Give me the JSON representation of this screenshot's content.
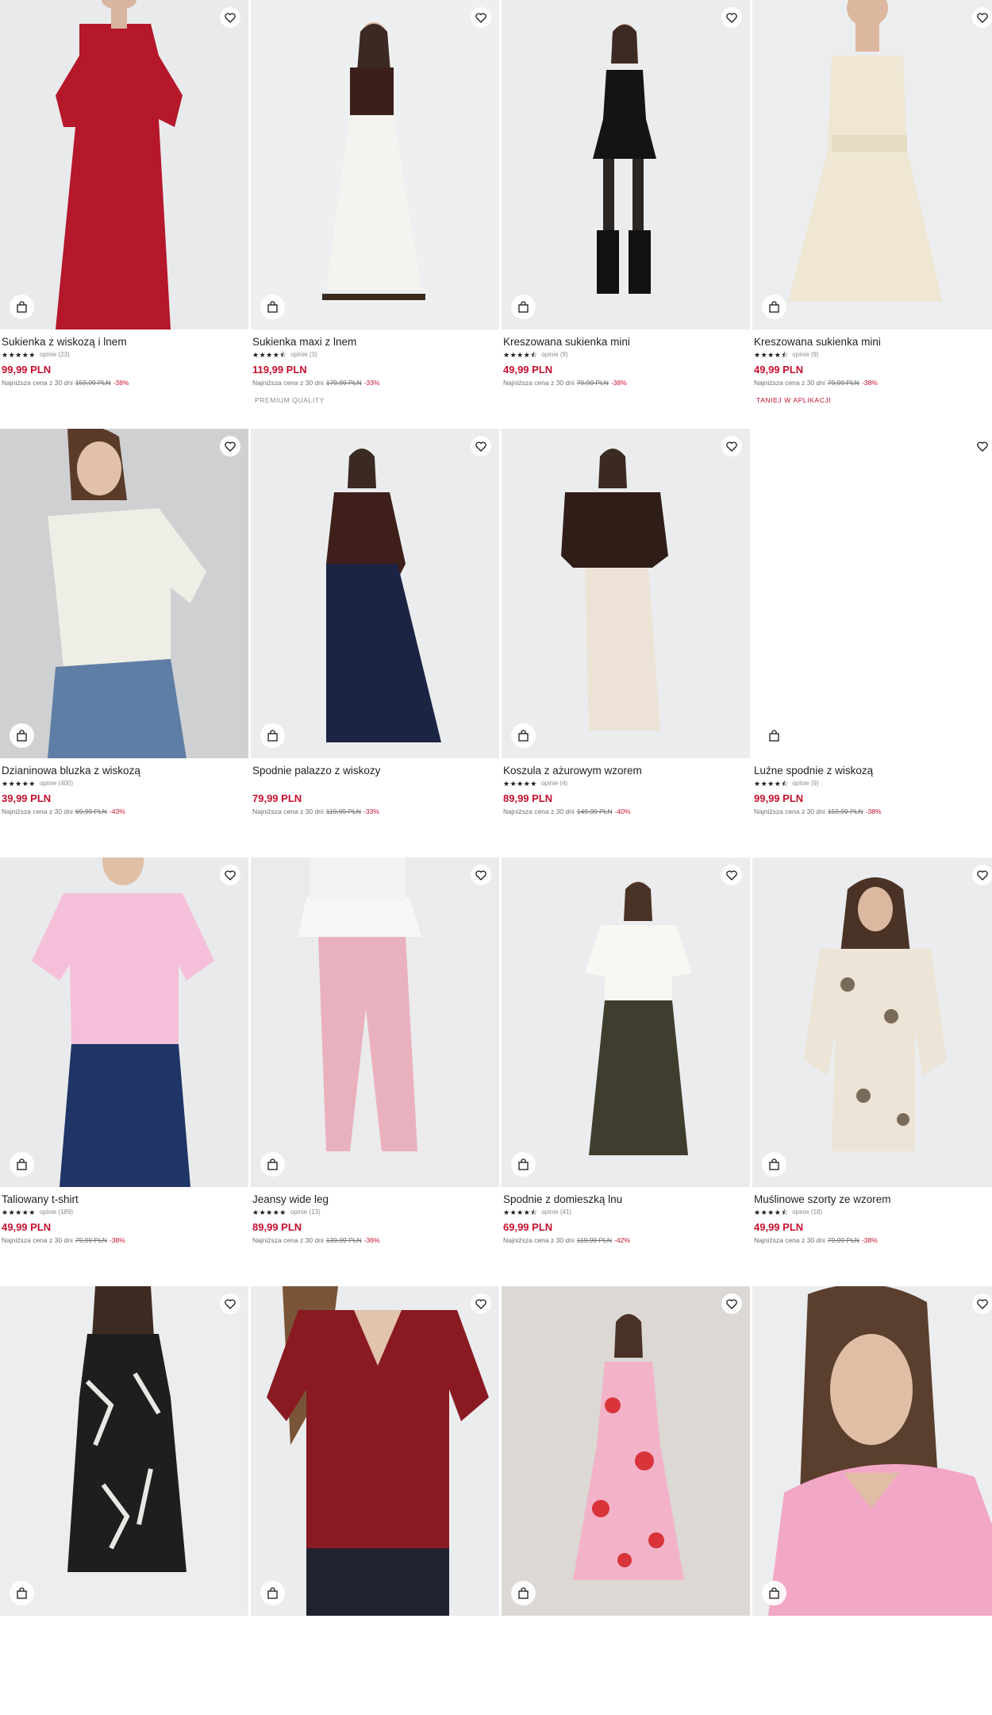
{
  "icons": {
    "wishlist": "heart-outline-icon",
    "add_to_bag": "shopping-bag-icon",
    "rating": "star-icon"
  },
  "colors": {
    "price": "#c8102e",
    "discount": "#c8102e",
    "text": "#1f1f1f",
    "muted": "#6e6e6e"
  },
  "products": [
    {
      "name": "Sukienka z wiskozą i lnem",
      "stars": "★★★★★",
      "reviews": "opinie (23)",
      "price": "99,99 PLN",
      "lowest_label": "Najniższa cena z 30 dni",
      "old_price": "159,99 PLN",
      "discount": "-38%",
      "badge": "",
      "rating": 5.0
    },
    {
      "name": "Sukienka maxi z lnem",
      "stars": "★★★★⯪",
      "reviews": "opinie (3)",
      "price": "119,99 PLN",
      "lowest_label": "Najniższa cena z 30 dni",
      "old_price": "179,99 PLN",
      "discount": "-33%",
      "badge": "PREMIUM QUALITY",
      "rating": 4.5
    },
    {
      "name": "Kreszowana sukienka mini",
      "stars": "★★★★⯪",
      "reviews": "opinie (9)",
      "price": "49,99 PLN",
      "lowest_label": "Najniższa cena z 30 dni",
      "old_price": "79,99 PLN",
      "discount": "-38%",
      "badge": "",
      "rating": 4.5
    },
    {
      "name": "Kreszowana sukienka mini",
      "stars": "★★★★⯪",
      "reviews": "opinie (9)",
      "price": "49,99 PLN",
      "lowest_label": "Najniższa cena z 30 dni",
      "old_price": "79,99 PLN",
      "discount": "-38%",
      "badge": "TANIEJ W APLIKACJI",
      "rating": 4.5
    },
    {
      "name": "Dzianinowa bluzka z wiskozą",
      "stars": "★★★★★",
      "reviews": "opinie (400)",
      "price": "39,99 PLN",
      "lowest_label": "Najniższa cena z 30 dni",
      "old_price": "69,99 PLN",
      "discount": "-43%",
      "badge": "",
      "rating": 5.0
    },
    {
      "name": "Spodnie palazzo z wiskozy",
      "stars": "",
      "reviews": "",
      "price": "79,99 PLN",
      "lowest_label": "Najniższa cena z 30 dni",
      "old_price": "119,99 PLN",
      "discount": "-33%",
      "badge": "",
      "rating": null
    },
    {
      "name": "Koszula z ażurowym wzorem",
      "stars": "★★★★★",
      "reviews": "opinie (4)",
      "price": "89,99 PLN",
      "lowest_label": "Najniższa cena z 30 dni",
      "old_price": "149,99 PLN",
      "discount": "-40%",
      "badge": "",
      "rating": 5.0
    },
    {
      "name": "Luźne spodnie z wiskozą",
      "stars": "★★★★⯪",
      "reviews": "opinie (9)",
      "price": "99,99 PLN",
      "lowest_label": "Najniższa cena z 30 dni",
      "old_price": "159,99 PLN",
      "discount": "-38%",
      "badge": "",
      "rating": 4.5
    },
    {
      "name": "Taliowany t-shirt",
      "stars": "★★★★★",
      "reviews": "opinie (189)",
      "price": "49,99 PLN",
      "lowest_label": "Najniższa cena z 30 dni",
      "old_price": "79,99 PLN",
      "discount": "-38%",
      "badge": "",
      "rating": 5.0
    },
    {
      "name": "Jeansy wide leg",
      "stars": "★★★★★",
      "reviews": "opinie (13)",
      "price": "89,99 PLN",
      "lowest_label": "Najniższa cena z 30 dni",
      "old_price": "139,99 PLN",
      "discount": "-36%",
      "badge": "",
      "rating": 5.0
    },
    {
      "name": "Spodnie z domieszką lnu",
      "stars": "★★★★⯪",
      "reviews": "opinie (41)",
      "price": "69,99 PLN",
      "lowest_label": "Najniższa cena z 30 dni",
      "old_price": "119,99 PLN",
      "discount": "-42%",
      "badge": "",
      "rating": 4.5
    },
    {
      "name": "Muślinowe szorty ze wzorem",
      "stars": "★★★★⯪",
      "reviews": "opinie (18)",
      "price": "49,99 PLN",
      "lowest_label": "Najniższa cena z 30 dni",
      "old_price": "79,99 PLN",
      "discount": "-38%",
      "badge": "",
      "rating": 4.5
    },
    {
      "name": "",
      "stars": "",
      "reviews": "",
      "price": "",
      "lowest_label": "",
      "old_price": "",
      "discount": "",
      "badge": ""
    },
    {
      "name": "",
      "stars": "",
      "reviews": "",
      "price": "",
      "lowest_label": "",
      "old_price": "",
      "discount": "",
      "badge": ""
    },
    {
      "name": "",
      "stars": "",
      "reviews": "",
      "price": "",
      "lowest_label": "",
      "old_price": "",
      "discount": "",
      "badge": ""
    },
    {
      "name": "",
      "stars": "",
      "reviews": "",
      "price": "",
      "lowest_label": "",
      "old_price": "",
      "discount": "",
      "badge": ""
    }
  ]
}
